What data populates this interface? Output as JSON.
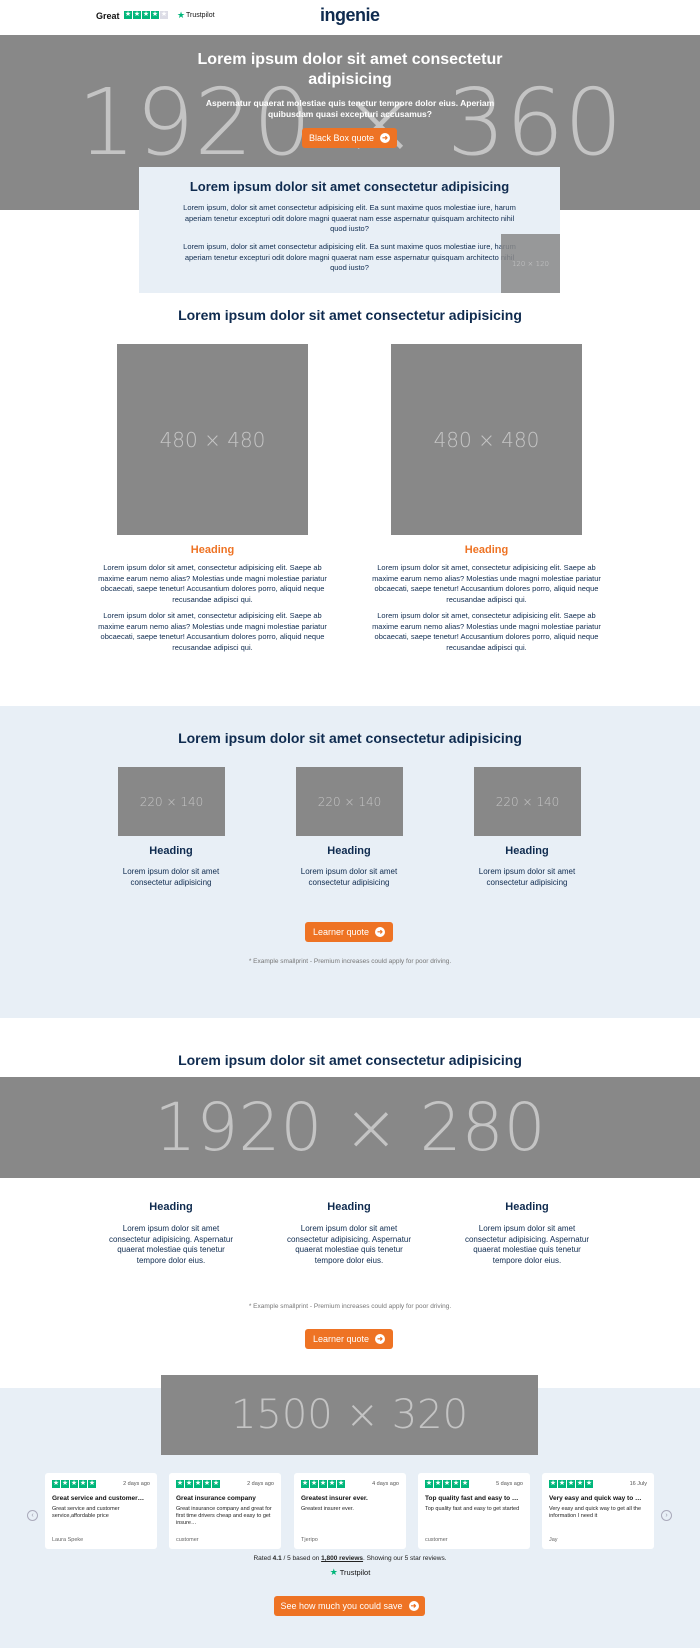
{
  "header": {
    "rating_word": "Great",
    "trustpilot": "Trustpilot",
    "logo": "ingenie"
  },
  "hero": {
    "placeholder": "1920 × 360",
    "title": "Lorem ipsum dolor sit amet consectetur adipisicing",
    "subtitle": "Aspernatur quaerat molestiae quis tenetur tempore dolor eius. Aperiam quibusdam quasi excepturi accusamus?",
    "button": "Black Box quote"
  },
  "intro_box": {
    "title": "Lorem ipsum dolor sit amet consectetur adipisicing",
    "p1": "Lorem ipsum, dolor sit amet consectetur adipisicing elit. Ea sunt maxime quos molestiae iure, harum aperiam tenetur excepturi odit dolore magni quaerat nam esse aspernatur quisquam architecto nihil quod iusto?",
    "p2": "Lorem ipsum, dolor sit amet consectetur adipisicing elit. Ea sunt maxime quos molestiae iure, harum aperiam tenetur excepturi odit dolore magni quaerat nam esse aspernatur quisquam architecto nihil quod iusto?",
    "thumb": "120 × 120"
  },
  "two_col": {
    "title": "Lorem ipsum dolor sit amet consectetur adipisicing",
    "cols": [
      {
        "img": "480 × 480",
        "heading": "Heading",
        "p1": "Lorem ipsum dolor sit amet, consectetur adipisicing elit. Saepe ab maxime earum nemo alias? Molestias unde magni molestiae pariatur obcaecati, saepe tenetur! Accusantium dolores porro, aliquid neque recusandae adipisci qui.",
        "p2": "Lorem ipsum dolor sit amet, consectetur adipisicing elit. Saepe ab maxime earum nemo alias? Molestias unde magni molestiae pariatur obcaecati, saepe tenetur! Accusantium dolores porro, aliquid neque recusandae adipisci qui."
      },
      {
        "img": "480 × 480",
        "heading": "Heading",
        "p1": "Lorem ipsum dolor sit amet, consectetur adipisicing elit. Saepe ab maxime earum nemo alias? Molestias unde magni molestiae pariatur obcaecati, saepe tenetur! Accusantium dolores porro, aliquid neque recusandae adipisci qui.",
        "p2": "Lorem ipsum dolor sit amet, consectetur adipisicing elit. Saepe ab maxime earum nemo alias? Molestias unde magni molestiae pariatur obcaecati, saepe tenetur! Accusantium dolores porro, aliquid neque recusandae adipisci qui."
      }
    ]
  },
  "three_col": {
    "title": "Lorem ipsum dolor sit amet consectetur adipisicing",
    "items": [
      {
        "img": "220 × 140",
        "heading": "Heading",
        "text": "Lorem ipsum dolor sit amet consectetur adipisicing"
      },
      {
        "img": "220 × 140",
        "heading": "Heading",
        "text": "Lorem ipsum dolor sit amet consectetur adipisicing"
      },
      {
        "img": "220 × 140",
        "heading": "Heading",
        "text": "Lorem ipsum dolor sit amet consectetur adipisicing"
      }
    ],
    "button": "Learner quote",
    "smallprint": "* Example smallprint - Premium increases could apply for poor driving."
  },
  "banner": {
    "title": "Lorem ipsum dolor sit amet consectetur adipisicing",
    "placeholder": "1920 × 280",
    "items": [
      {
        "heading": "Heading",
        "text": "Lorem ipsum dolor sit amet consectetur adipisicing. Aspernatur quaerat molestiae quis tenetur tempore dolor eius."
      },
      {
        "heading": "Heading",
        "text": "Lorem ipsum dolor sit amet consectetur adipisicing. Aspernatur quaerat molestiae quis tenetur tempore dolor eius."
      },
      {
        "heading": "Heading",
        "text": "Lorem ipsum dolor sit amet consectetur adipisicing. Aspernatur quaerat molestiae quis tenetur tempore dolor eius."
      }
    ],
    "smallprint": "* Example smallprint - Premium increases could apply for poor driving.",
    "button": "Learner quote"
  },
  "reviews": {
    "placeholder": "1500 × 320",
    "cards": [
      {
        "date": "2 days ago",
        "title": "Great service and customer…",
        "body": "Great service and customer service,affordable price",
        "author": "Laura Speke"
      },
      {
        "date": "2 days ago",
        "title": "Great insurance company",
        "body": "Great insurance company and great for first time drivers cheap and easy to get insure…",
        "author": "customer"
      },
      {
        "date": "4 days ago",
        "title": "Greatest insurer ever.",
        "body": "Greatest insurer ever.",
        "author": "Tjeripo"
      },
      {
        "date": "5 days ago",
        "title": "Top quality fast and easy to …",
        "body": "Top quality fast and easy to get started",
        "author": "customer"
      },
      {
        "date": "16 July",
        "title": "Very easy and quick way to …",
        "body": "Very easy and quick way to get all the information I need it",
        "author": "Jay"
      }
    ],
    "rated_prefix": "Rated",
    "rating": "4.1",
    "rated_mid": "/ 5 based on",
    "review_count": "1,800 reviews",
    "rated_suffix": ". Showing our 5 star reviews.",
    "trustpilot": "Trustpilot",
    "button": "See how much you could save"
  }
}
